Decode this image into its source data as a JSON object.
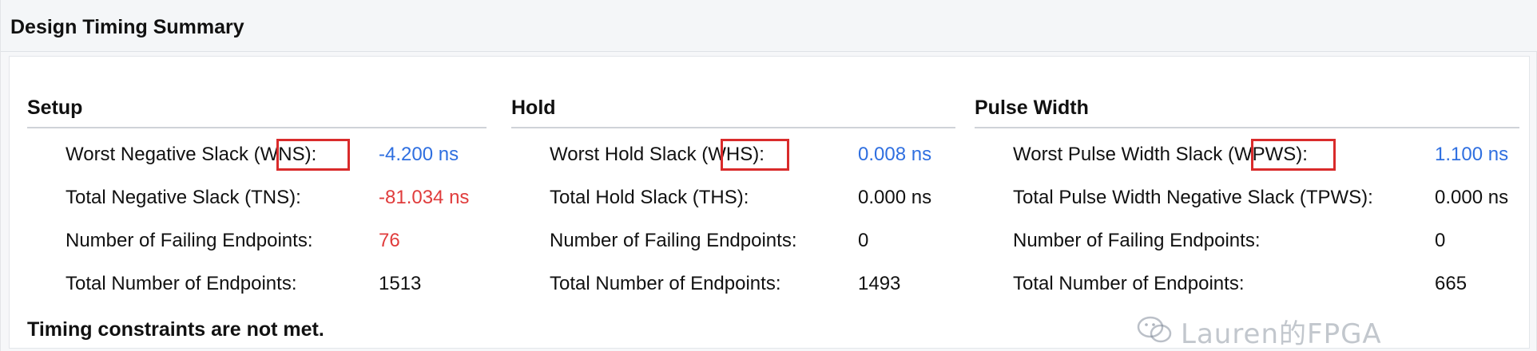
{
  "window": {
    "title": "Design Timing Summary"
  },
  "setup": {
    "header": "Setup",
    "rows": [
      {
        "label": "Worst Negative Slack (WNS):",
        "value": "-4.200 ns",
        "status": "blue",
        "highlight": "(WNS)"
      },
      {
        "label": "Total Negative Slack (TNS):",
        "value": "-81.034 ns",
        "status": "red"
      },
      {
        "label": "Number of Failing Endpoints:",
        "value": "76",
        "status": "red"
      },
      {
        "label": "Total Number of Endpoints:",
        "value": "1513",
        "status": "normal"
      }
    ]
  },
  "hold": {
    "header": "Hold",
    "rows": [
      {
        "label": "Worst Hold Slack (WHS):",
        "value": "0.008 ns",
        "status": "blue",
        "highlight": "(WHS)"
      },
      {
        "label": "Total Hold Slack (THS):",
        "value": "0.000 ns",
        "status": "normal"
      },
      {
        "label": "Number of Failing Endpoints:",
        "value": "0",
        "status": "normal"
      },
      {
        "label": "Total Number of Endpoints:",
        "value": "1493",
        "status": "normal"
      }
    ]
  },
  "pulse": {
    "header": "Pulse Width",
    "rows": [
      {
        "label": "Worst Pulse Width Slack (WPWS):",
        "value": "1.100 ns",
        "status": "blue",
        "highlight": "(WPWS)"
      },
      {
        "label": "Total Pulse Width Negative Slack (TPWS):",
        "value": "0.000 ns",
        "status": "normal"
      },
      {
        "label": "Number of Failing Endpoints:",
        "value": "0",
        "status": "normal"
      },
      {
        "label": "Total Number of Endpoints:",
        "value": "665",
        "status": "normal"
      }
    ]
  },
  "footer": {
    "message": "Timing constraints are not met."
  },
  "watermark": {
    "text": "Lauren的FPGA",
    "icon": "wechat-icon"
  },
  "colors": {
    "link_blue": "#2f6fe0",
    "error_red": "#e03c3c",
    "highlight_box": "#d92b2b"
  }
}
